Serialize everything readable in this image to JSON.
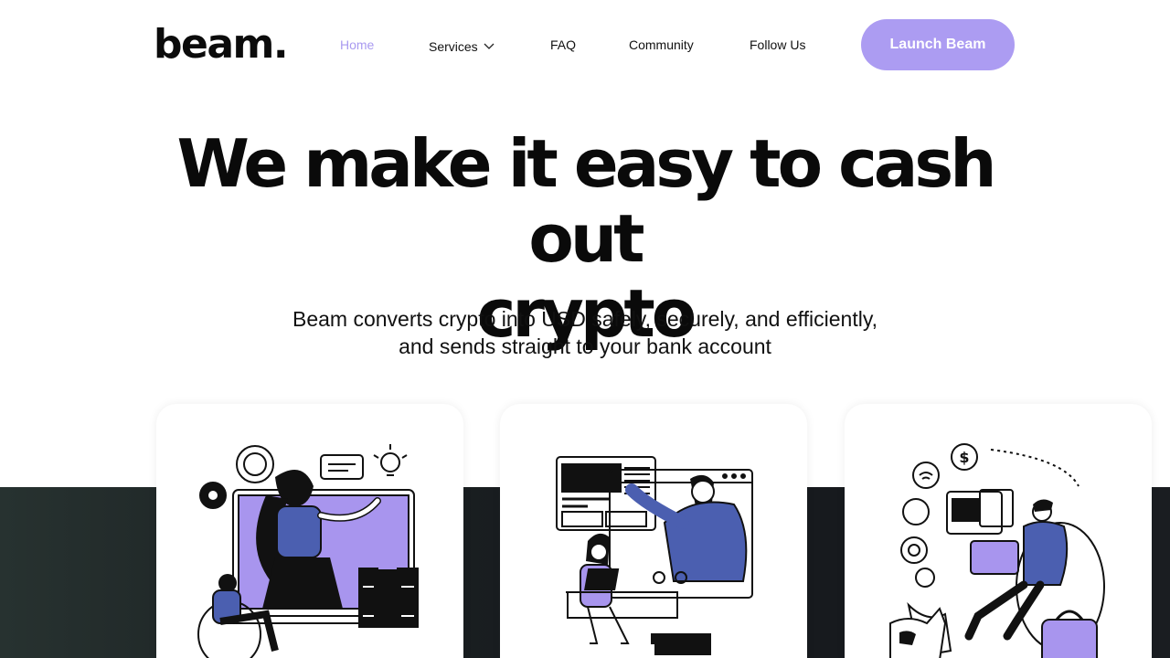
{
  "brand": {
    "logo": "beam."
  },
  "nav": {
    "items": [
      {
        "label": "Home",
        "active": true
      },
      {
        "label": "Services",
        "has_dropdown": true
      },
      {
        "label": "FAQ"
      },
      {
        "label": "Community"
      },
      {
        "label": "Follow Us"
      }
    ],
    "cta_label": "Launch Beam"
  },
  "hero": {
    "title_line1": "We make it easy to cash out",
    "title_line2": "crypto",
    "subtitle_line1": "Beam converts crypto into USD safely, securely, and efficiently,",
    "subtitle_line2": "and sends straight to your bank account"
  },
  "cards": [
    {
      "illustration": "woman-presenting-online-illustration"
    },
    {
      "illustration": "online-meeting-laptop-illustration"
    },
    {
      "illustration": "man-remote-work-laptop-illustration"
    }
  ],
  "colors": {
    "accent": "#ac9cf2",
    "nav_active": "#a99af0",
    "illustration_blue": "#4b5fb0",
    "illustration_purple": "#a895ee",
    "dark_band": "#1b2022"
  }
}
